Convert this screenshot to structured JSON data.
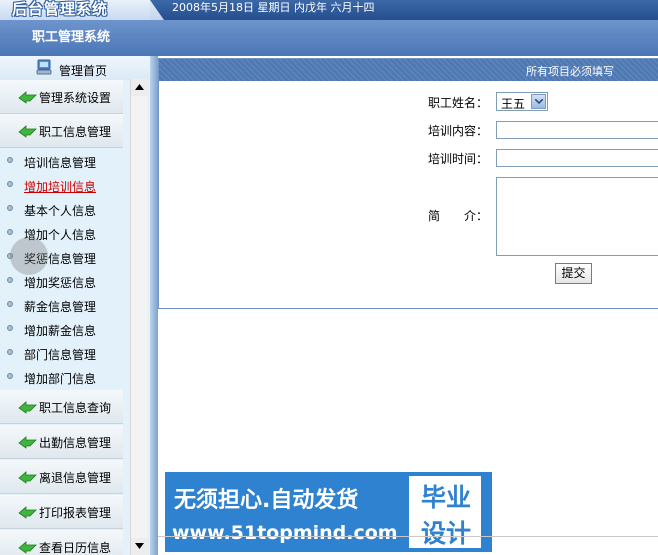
{
  "header": {
    "logo_text": "后台管理系统",
    "date_text": "2008年5月18日 星期日 内戊年 六月十四",
    "system_title": "职工管理系统"
  },
  "sidebar": {
    "home_label": "管理首页",
    "menus": [
      {
        "label": "管理系统设置"
      },
      {
        "label": "职工信息管理"
      }
    ],
    "items": [
      {
        "label": "培训信息管理"
      },
      {
        "label": "增加培训信息"
      },
      {
        "label": "基本个人信息"
      },
      {
        "label": "增加个人信息"
      },
      {
        "label": "奖惩信息管理"
      },
      {
        "label": "增加奖惩信息"
      },
      {
        "label": "薪金信息管理"
      },
      {
        "label": "增加薪金信息"
      },
      {
        "label": "部门信息管理"
      },
      {
        "label": "增加部门信息"
      }
    ],
    "menus_bottom": [
      {
        "label": "职工信息查询"
      },
      {
        "label": "出勤信息管理"
      },
      {
        "label": "离退信息管理"
      },
      {
        "label": "打印报表管理"
      },
      {
        "label": "查看日历信息"
      }
    ]
  },
  "form": {
    "header_note": "所有项目必须填写",
    "name_label": "职工姓名：",
    "name_value": "王五",
    "content_label": "培训内容：",
    "time_label": "培训时间：",
    "intro_label": "简　　介：",
    "submit_label": "提交"
  },
  "watermark": {
    "line1": "无须担心.自动发货",
    "line2": "www.51topmind.com",
    "box_line1": "毕业",
    "box_line2": "设计"
  },
  "colors": {
    "accent": "#4b76b6",
    "sidebar_bg": "#e3f1fa",
    "active_link": "#cc0000",
    "watermark_bg": "#2f82cf"
  }
}
